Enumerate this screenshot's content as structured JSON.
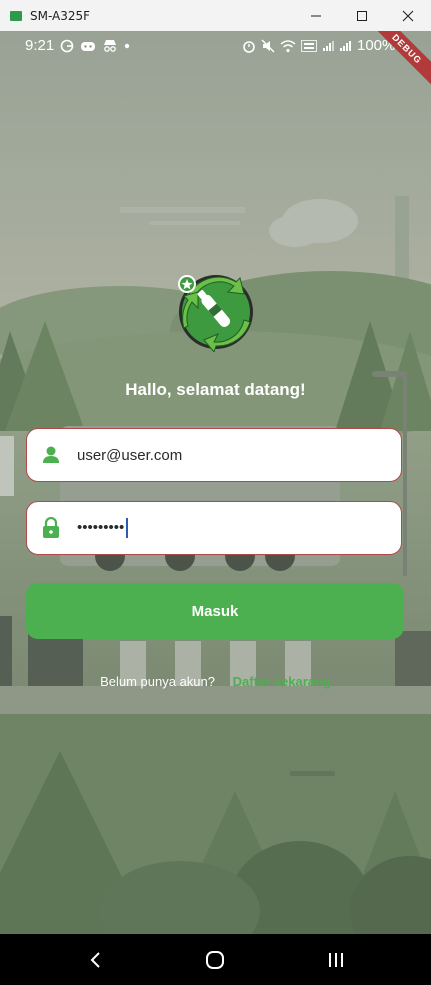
{
  "window": {
    "title": "SM-A325F"
  },
  "status_bar": {
    "time": "9:21",
    "battery": "100%",
    "debug_label": "DEBUG"
  },
  "login": {
    "welcome": "Hallo, selamat datang!",
    "email_value": "user@user.com",
    "password_value": "•••••••••",
    "submit_label": "Masuk",
    "register_prompt": "Belum punya akun?",
    "register_link": "Daftar sekarang"
  },
  "colors": {
    "accent": "#4caf50",
    "field_border": "#b04a4a",
    "navbar": "#000000"
  },
  "icons": {
    "app": "android-app-icon",
    "minimize": "minimize-icon",
    "maximize": "maximize-icon",
    "close": "close-icon",
    "email": "person-icon",
    "password": "lock-icon",
    "back": "back-icon",
    "home": "home-icon",
    "recents": "recents-icon"
  }
}
